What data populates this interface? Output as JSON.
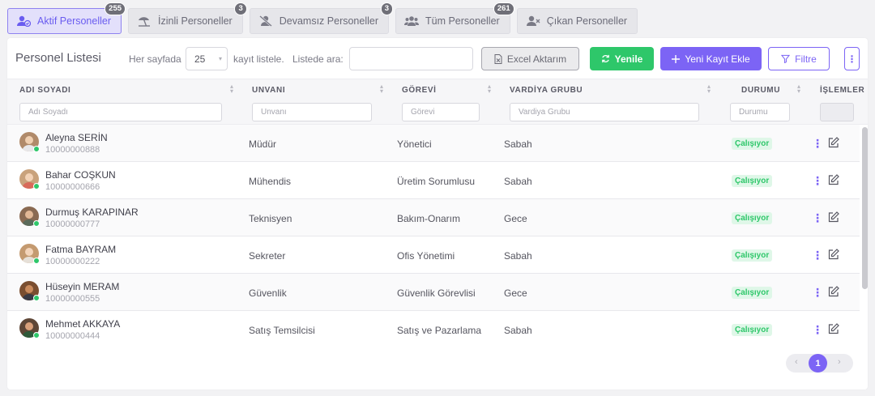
{
  "tabs": [
    {
      "label": "Aktif Personeller",
      "badge": "255",
      "icon": "user-check-icon"
    },
    {
      "label": "İzinli Personeller",
      "badge": "3",
      "icon": "beach-umbrella-icon"
    },
    {
      "label": "Devamsız Personeller",
      "badge": "3",
      "icon": "user-slash-icon"
    },
    {
      "label": "Tüm Personeller",
      "badge": "261",
      "icon": "users-icon"
    },
    {
      "label": "Çıkan Personeller",
      "badge": "",
      "icon": "user-remove-icon"
    }
  ],
  "toolbar": {
    "title": "Personel Listesi",
    "per_page_label": "Her sayfada",
    "per_page_value": "25",
    "per_page_suffix": "kayıt listele.",
    "search_label": "Listede ara:",
    "search_value": "",
    "excel_label": "Excel Aktarım",
    "refresh_label": "Yenile",
    "new_label": "Yeni Kayıt Ekle",
    "filter_label": "Filtre",
    "more_label": "⋮"
  },
  "columns": {
    "name": "ADI SOYADI",
    "title": "UNVANI",
    "role": "GÖREVİ",
    "shift": "VARDİYA GRUBU",
    "status": "DURUMU",
    "actions": "İŞLEMLER"
  },
  "filters": {
    "name_placeholder": "Adı Soyadı",
    "title_placeholder": "Unvanı",
    "role_placeholder": "Görevi",
    "shift_placeholder": "Vardiya Grubu",
    "status_placeholder": "Durumu"
  },
  "rows": [
    {
      "name": "Aleyna SERİN",
      "id": "10000000888",
      "title": "Müdür",
      "role": "Yönetici",
      "shift": "Sabah",
      "status": "Çalışıyor",
      "avatar_color": "#b08a6a"
    },
    {
      "name": "Bahar COŞKUN",
      "id": "10000000666",
      "title": "Mühendis",
      "role": "Üretim Sorumlusu",
      "shift": "Sabah",
      "status": "Çalışıyor",
      "avatar_color": "#c9a27c"
    },
    {
      "name": "Durmuş KARAPINAR",
      "id": "10000000777",
      "title": "Teknisyen",
      "role": "Bakım-Onarım",
      "shift": "Gece",
      "status": "Çalışıyor",
      "avatar_color": "#8a6a52"
    },
    {
      "name": "Fatma BAYRAM",
      "id": "10000000222",
      "title": "Sekreter",
      "role": "Ofis Yönetimi",
      "shift": "Sabah",
      "status": "Çalışıyor",
      "avatar_color": "#c49a70"
    },
    {
      "name": "Hüseyin MERAM",
      "id": "10000000555",
      "title": "Güvenlik",
      "role": "Güvenlik Görevlisi",
      "shift": "Gece",
      "status": "Çalışıyor",
      "avatar_color": "#7a4e30"
    },
    {
      "name": "Mehmet AKKAYA",
      "id": "10000000444",
      "title": "Satış Temsilcisi",
      "role": "Satış ve Pazarlama",
      "shift": "Sabah",
      "status": "Çalışıyor",
      "avatar_color": "#5e4636"
    }
  ],
  "pagination": {
    "current": "1",
    "prev": "‹",
    "next": "›"
  },
  "colors": {
    "accent": "#7c64f5",
    "success": "#2ec76a",
    "status_bg": "#dff7e8"
  }
}
